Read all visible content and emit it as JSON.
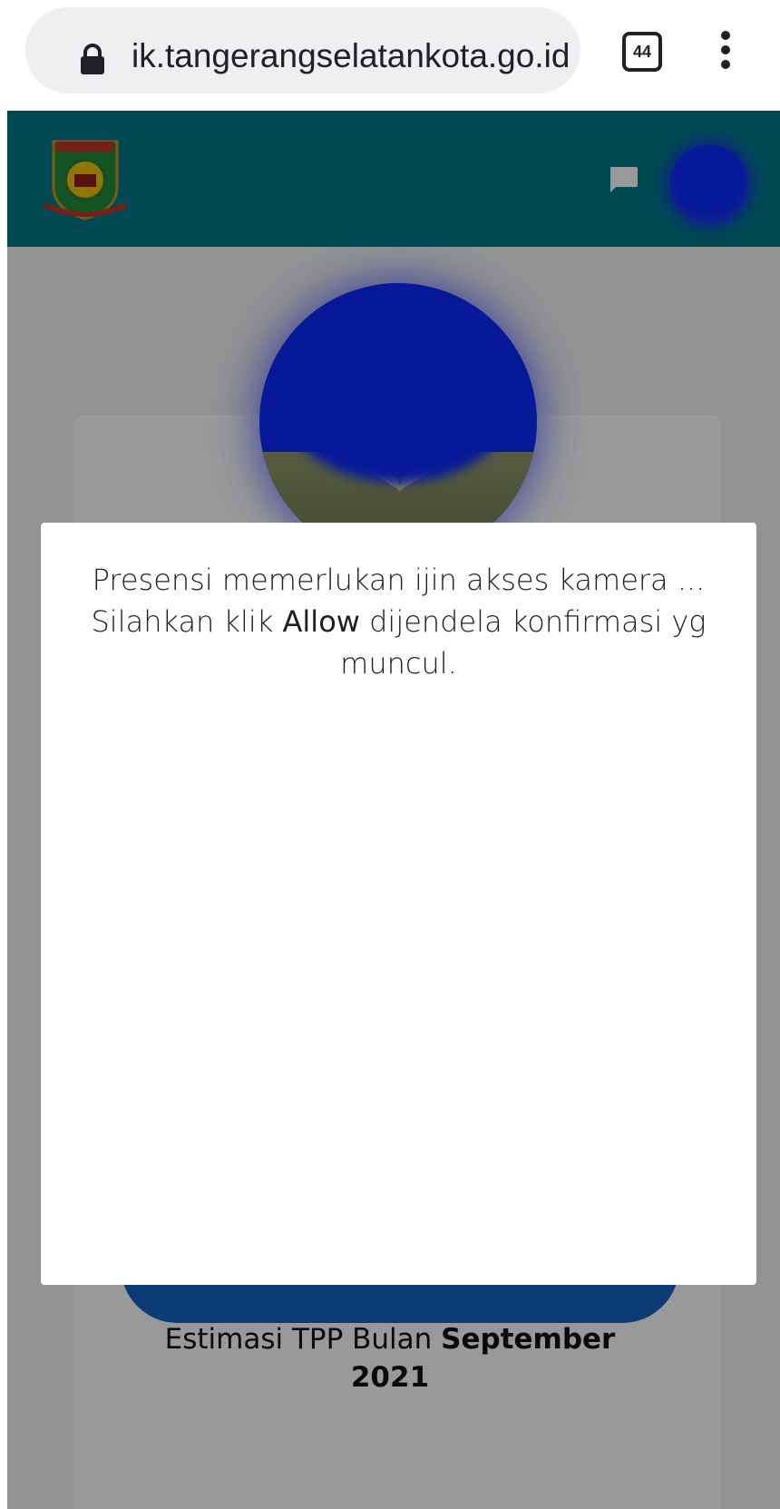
{
  "browser": {
    "url": "ik.tangerangselatankota.go.id",
    "tab_count": "44"
  },
  "app": {
    "header_color": "#027a8b",
    "icons": [
      "city-emblem-logo",
      "chat-icon",
      "avatar"
    ]
  },
  "modal": {
    "message_part1": "Presensi memerlukan ijin akses kamera ... Silahkan klik ",
    "message_strong": "Allow",
    "message_part2": " dijendela konfirmasi yg muncul."
  },
  "tpp": {
    "prefix": "Estimasi TPP Bulan ",
    "month": "September",
    "year": "2021"
  },
  "colors": {
    "accent": "#027a8b",
    "button": "#1565c0"
  }
}
